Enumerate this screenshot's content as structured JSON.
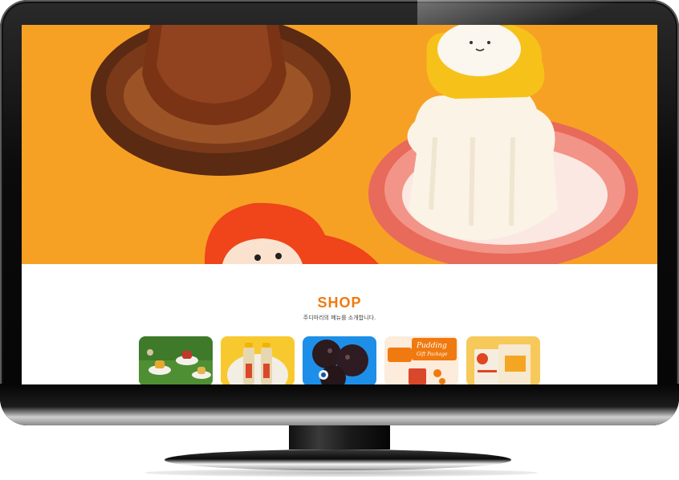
{
  "shop": {
    "title": "SHOP",
    "subtitle": "주디마리의 메뉴를 소개합니다."
  },
  "colors": {
    "accent": "#f07a10",
    "hero_background": "#f7a124"
  }
}
